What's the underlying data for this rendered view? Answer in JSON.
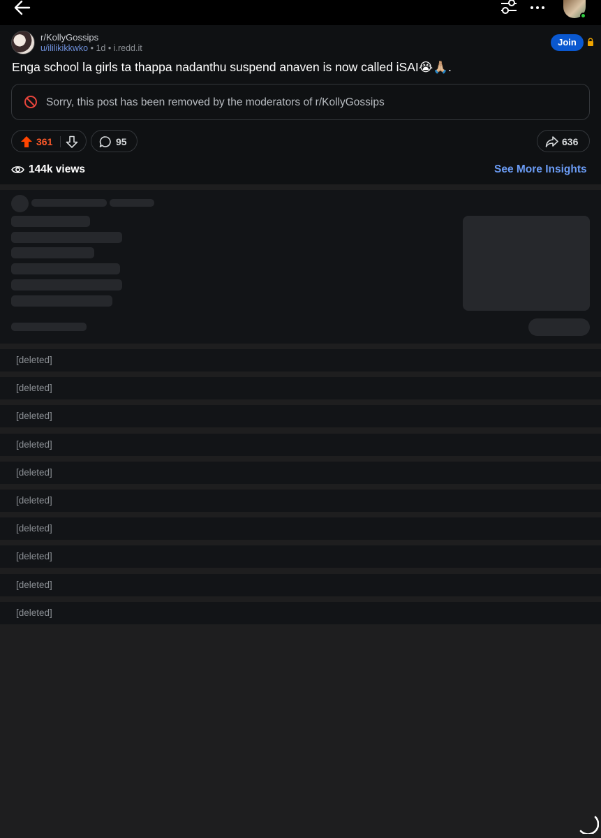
{
  "topbar": {
    "back_icon": "arrow-left-icon",
    "filter_icon": "sliders-icon",
    "more_icon": "more-horizontal-icon"
  },
  "post": {
    "subreddit": "r/KollyGossips",
    "author": "u/ililikikkwko",
    "separator": "•",
    "age": "1d",
    "domain": "i.redd.it",
    "join_label": "Join",
    "title": "Enga school la girls ta thappa nadanthu suspend anaven is now called iSAI😭🙏🏼.",
    "removed_message": "Sorry, this post has been removed by the moderators of r/KollyGossips",
    "upvotes": "361",
    "comments": "95",
    "shares": "636",
    "views": "144k views",
    "insights_label": "See More Insights"
  },
  "comments": [
    {
      "text": "[deleted]"
    },
    {
      "text": "[deleted]"
    },
    {
      "text": "[deleted]"
    },
    {
      "text": "[deleted]"
    },
    {
      "text": "[deleted]"
    },
    {
      "text": "[deleted]"
    },
    {
      "text": "[deleted]"
    },
    {
      "text": "[deleted]"
    },
    {
      "text": "[deleted]"
    },
    {
      "text": "[deleted]"
    }
  ],
  "colors": {
    "accent_upvote": "#ff5a2a",
    "join_button": "#0a58d0",
    "link": "#6b9cf5",
    "online": "#2ecc40"
  }
}
